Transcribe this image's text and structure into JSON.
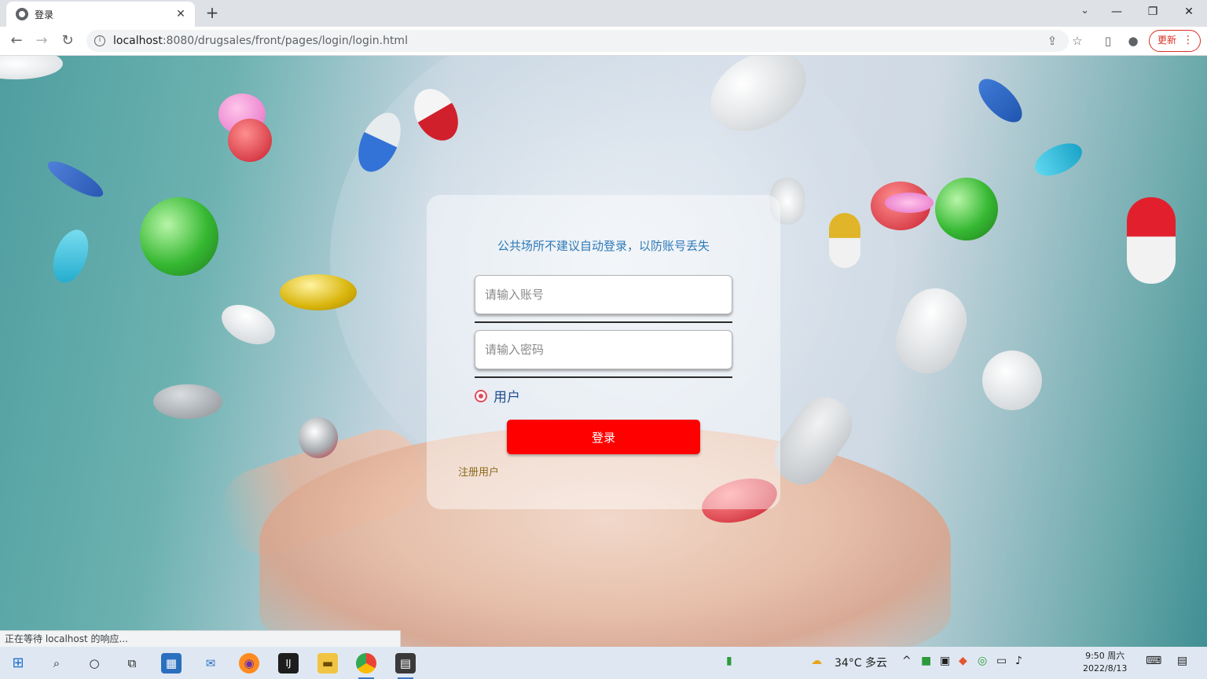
{
  "browser": {
    "tab_title": "登录",
    "tab_close": "✕",
    "new_tab": "+",
    "url_host": "localhost",
    "url_rest": ":8080/drugsales/front/pages/login/login.html",
    "update_label": "更新",
    "status_text": "正在等待 localhost 的响应..."
  },
  "login": {
    "tip": "公共场所不建议自动登录，以防账号丢失",
    "account_placeholder": "请输入账号",
    "password_placeholder": "请输入密码",
    "role_option": "用户",
    "submit_label": "登录",
    "register_link": "注册用户"
  },
  "taskbar": {
    "weather": "34°C 多云",
    "time": "9:50 周六",
    "date": "2022/8/13"
  },
  "colors": {
    "accent_red": "#ff0000",
    "tip_blue": "#2e79b7"
  }
}
